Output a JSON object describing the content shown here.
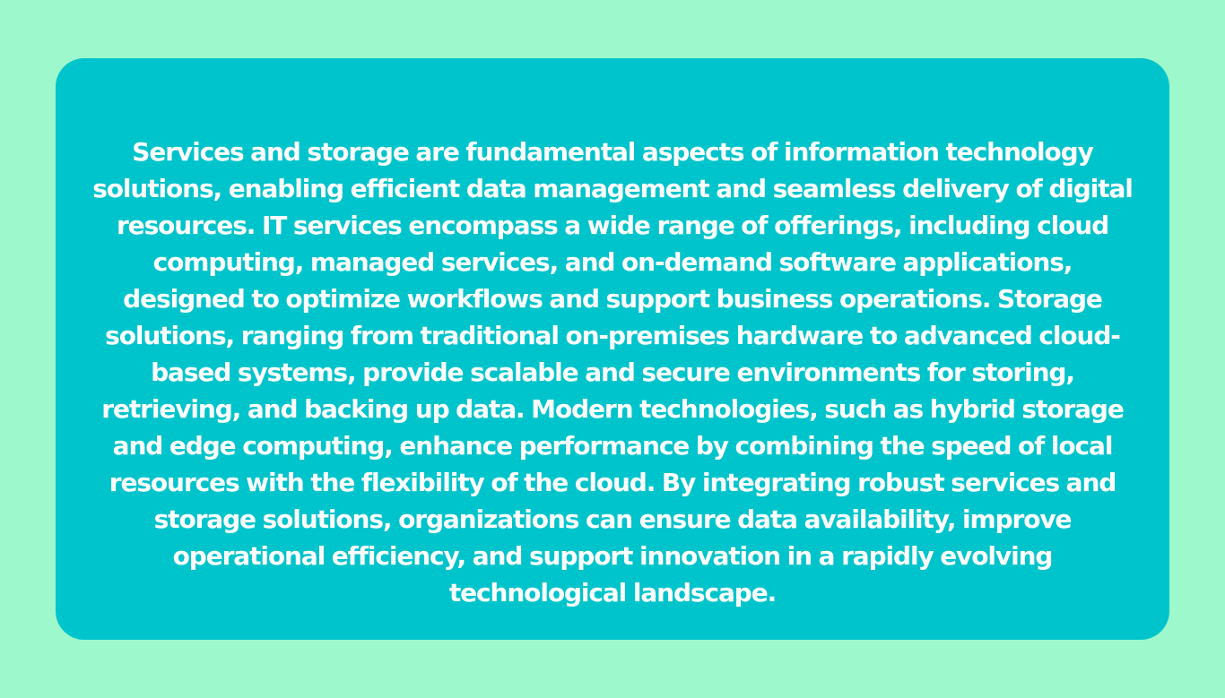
{
  "colors": {
    "page_background": "#9df8cb",
    "card_background": "#00c4cb",
    "text": "#ffffff"
  },
  "card": {
    "text": "Services and storage are fundamental aspects of information technology solutions, enabling efficient data management and seamless delivery of digital resources. IT services encompass a wide range of offerings, including cloud computing, managed services, and on-demand software applications, designed to optimize workflows and support business operations. Storage solutions, ranging from traditional on-premises hardware to advanced cloud-based systems, provide scalable and secure environments for storing, retrieving, and backing up data. Modern technologies, such as hybrid storage and edge computing, enhance performance by combining the speed of local resources with the flexibility of the cloud. By integrating robust services and storage solutions, organizations can ensure data availability, improve operational efficiency, and support innovation in a rapidly evolving technological landscape."
  }
}
